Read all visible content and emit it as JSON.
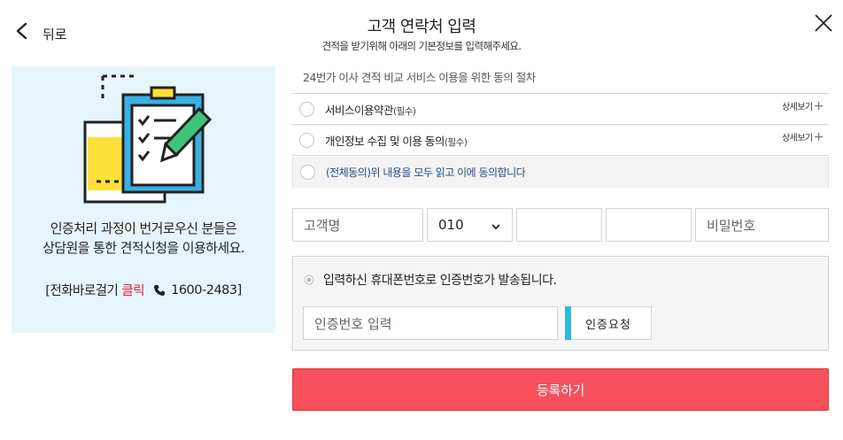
{
  "header": {
    "back_label": "뒤로",
    "title": "고객 연락처 입력",
    "subtitle": "견적을 받기위해 아래의 기본정보를 입력해주세요."
  },
  "left_panel": {
    "promo_line1": "인증처리 과정이 번거로우신 분들은",
    "promo_line2": "상담원을 통한 견적신청을 이용하세요.",
    "phone_prefix": "[전화바로걸기",
    "click_label": "클릭",
    "phone_number": "1600-2483]",
    "accent_color": "#e0203a"
  },
  "consent": {
    "heading": "24번가 이사 견적 비교 서비스 이용을 위한 동의 절차",
    "items": [
      {
        "label": "서비스이용약관",
        "required": "(필수)",
        "detail": "상세보기",
        "detail_icon": "plus-icon"
      },
      {
        "label": "개인정보 수집 및 이용 동의",
        "required": "(필수)",
        "detail": "상세보기",
        "detail_icon": "plus-icon"
      }
    ],
    "all_agree": "(전체동의)위 내용을 모두 읽고 이에 동의합니다"
  },
  "form": {
    "name_placeholder": "고객명",
    "phone_prefix_value": "010",
    "phone_mid_value": "",
    "phone_last_value": "",
    "password_placeholder": "비밀번호"
  },
  "verify": {
    "notice": "입력하신 휴대폰번호로 인증번호가 발송됩니다.",
    "code_placeholder": "인증번호 입력",
    "request_label": "인증요청",
    "accent_color": "#2fb8e6"
  },
  "submit": {
    "label": "등록하기",
    "color": "#f6505a"
  }
}
